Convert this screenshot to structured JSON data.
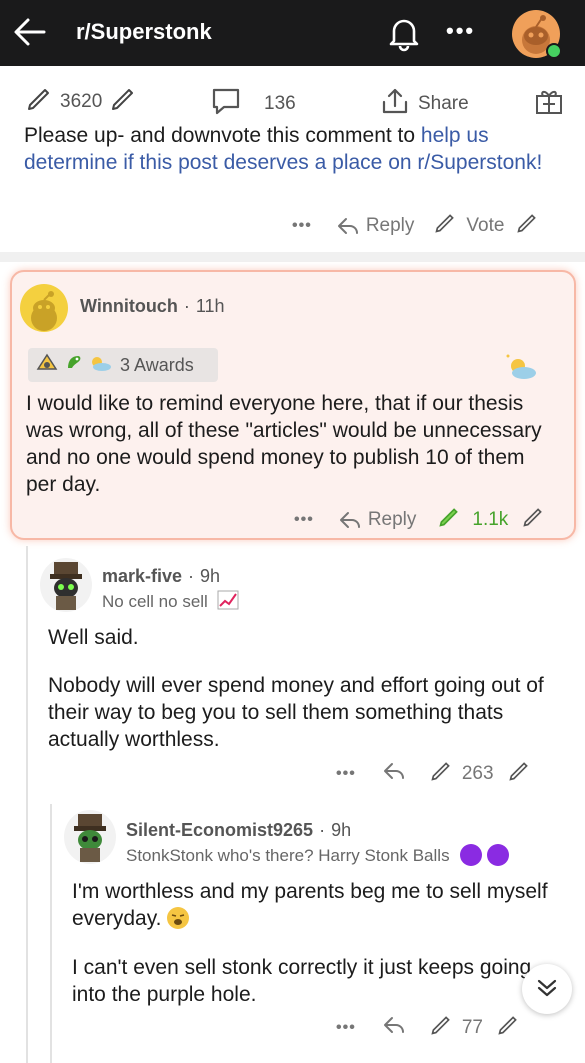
{
  "header": {
    "title": "r/Superstonk"
  },
  "post_bar": {
    "upvotes": "3620",
    "comments": "136",
    "share": "Share"
  },
  "mod_comment": {
    "text_plain": "Please up- and downvote this comment to ",
    "text_link": "help us determine if this post deserves a place on r/Superstonk!",
    "reply": "Reply",
    "vote": "Vote"
  },
  "highlighted_comment": {
    "author": "Winnitouch",
    "time": "11h",
    "awards": "3 Awards",
    "body": "I would like to remind everyone here, that if our thesis was wrong, all of these \"articles\" would be unnecessary and no one would spend money to publish 10 of them per day.",
    "reply": "Reply",
    "score": "1.1k"
  },
  "reply_1": {
    "author": "mark-five",
    "time": "9h",
    "flair": "No cell no sell",
    "body_1": "Well said.",
    "body_2": "Nobody will ever spend money and effort going out of their way to beg you to sell them something thats actually worthless.",
    "score": "263"
  },
  "reply_2": {
    "author": "Silent-Economist9265",
    "time": "9h",
    "flair": "StonkStonk who's there? Harry Stonk Balls",
    "body_1": "I'm worthless and my parents beg me to sell myself everyday.",
    "body_2": "I can't even sell stonk correctly it just keeps going into the purple hole.",
    "score": "77"
  },
  "colors": {
    "link": "#3a5ba6",
    "upvote_green": "#46a32b",
    "highlight_border": "#f7b8a6",
    "topbar": "#1a1a1b",
    "purple": "#8a2be2"
  },
  "icons": [
    "back-arrow-icon",
    "bell-icon",
    "more-icon",
    "avatar",
    "upvote-icon",
    "downvote-icon",
    "comment-icon",
    "share-icon",
    "gift-icon",
    "reply-icon",
    "chevron-down-icon"
  ]
}
